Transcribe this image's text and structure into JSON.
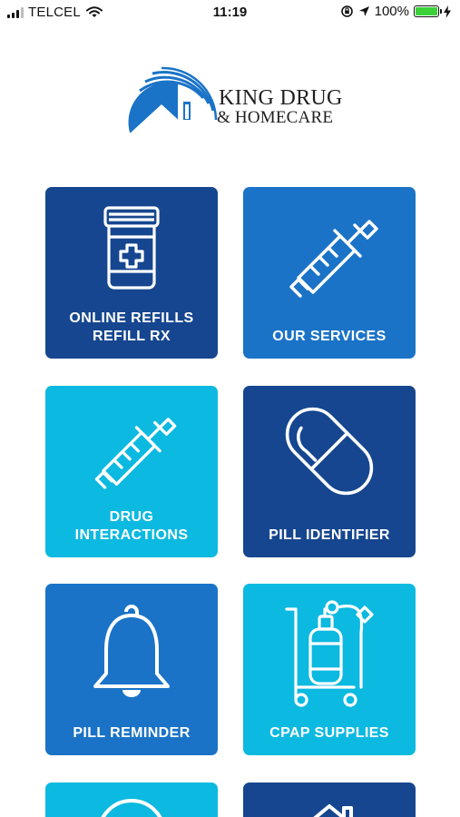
{
  "status_bar": {
    "carrier": "TELCEL",
    "time": "11:19",
    "battery_percent": "100%",
    "battery_level": 1.0,
    "icons": [
      "signal-icon",
      "wifi-icon",
      "rotation-lock-icon",
      "location-arrow-icon",
      "battery-icon",
      "charging-bolt-icon"
    ]
  },
  "brand": {
    "name": "KING DRUG",
    "sub": "& HOMECARE",
    "color": "#1a73c7"
  },
  "colors": {
    "navy": "#16468f",
    "mid_blue": "#1a73c7",
    "cyan": "#0cb9e0"
  },
  "tiles": [
    {
      "label_line1": "ONLINE REFILLS",
      "label_line2": "REFILL RX",
      "icon": "pill-bottle-icon",
      "color": "navy"
    },
    {
      "label_line1": "OUR SERVICES",
      "label_line2": "",
      "icon": "syringe-icon",
      "color": "mid_blue"
    },
    {
      "label_line1": "DRUG",
      "label_line2": "INTERACTIONS",
      "icon": "syringe-icon",
      "color": "cyan"
    },
    {
      "label_line1": "PILL IDENTIFIER",
      "label_line2": "",
      "icon": "capsule-icon",
      "color": "navy"
    },
    {
      "label_line1": "PILL REMINDER",
      "label_line2": "",
      "icon": "bell-icon",
      "color": "mid_blue"
    },
    {
      "label_line1": "CPAP SUPPLIES",
      "label_line2": "",
      "icon": "oxygen-tank-cart-icon",
      "color": "cyan"
    },
    {
      "label_line1": "",
      "label_line2": "",
      "icon": "partial-tile-icon",
      "color": "cyan"
    },
    {
      "label_line1": "",
      "label_line2": "",
      "icon": "home-icon",
      "color": "navy"
    }
  ]
}
